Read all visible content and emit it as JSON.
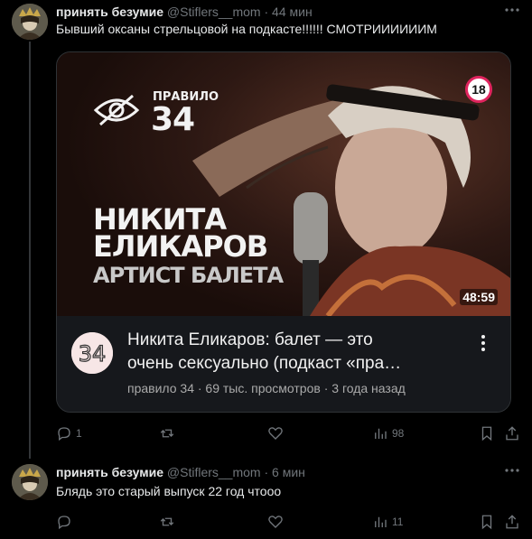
{
  "tweets": [
    {
      "name": "принять безумие",
      "handle": "@Stiflers__mom",
      "sep": "·",
      "time": "44 мин",
      "text": "Бывший оксаны стрельцовой на подкасте!!!!!! СМОТРИИИИИИМ",
      "card": {
        "thumb_rule": "ПРАВИЛО",
        "thumb_number": "34",
        "thumb_line1": "НИКИТА",
        "thumb_line2": "ЕЛИКАРОВ",
        "thumb_line3": "АРТИСТ БАЛЕТА",
        "age_badge": "18",
        "duration": "48:59",
        "title_line1": "Никита Еликаров: балет — это",
        "title_line2": "очень сексуально (подкаст «пра…",
        "subtitle": "правило 34 · 69 тыс. просмотров · 3 года назад",
        "channel_logo_text": "34"
      },
      "replies": "1",
      "reposts": "",
      "likes": "",
      "views": "98"
    },
    {
      "name": "принять безумие",
      "handle": "@Stiflers__mom",
      "sep": "·",
      "time": "6 мин",
      "text": "Блядь это старый выпуск 22 год чтооо",
      "replies": "",
      "reposts": "",
      "likes": "",
      "views": "11"
    }
  ],
  "colors": {
    "background": "#000000",
    "text": "#e7e9ea",
    "muted": "#71767b",
    "card_bg": "#16181c",
    "badge_red": "#e0245e"
  },
  "icons": [
    "reply-icon",
    "repost-icon",
    "like-icon",
    "views-icon",
    "bookmark-icon",
    "share-icon",
    "more-icon",
    "eye-slash-icon"
  ]
}
